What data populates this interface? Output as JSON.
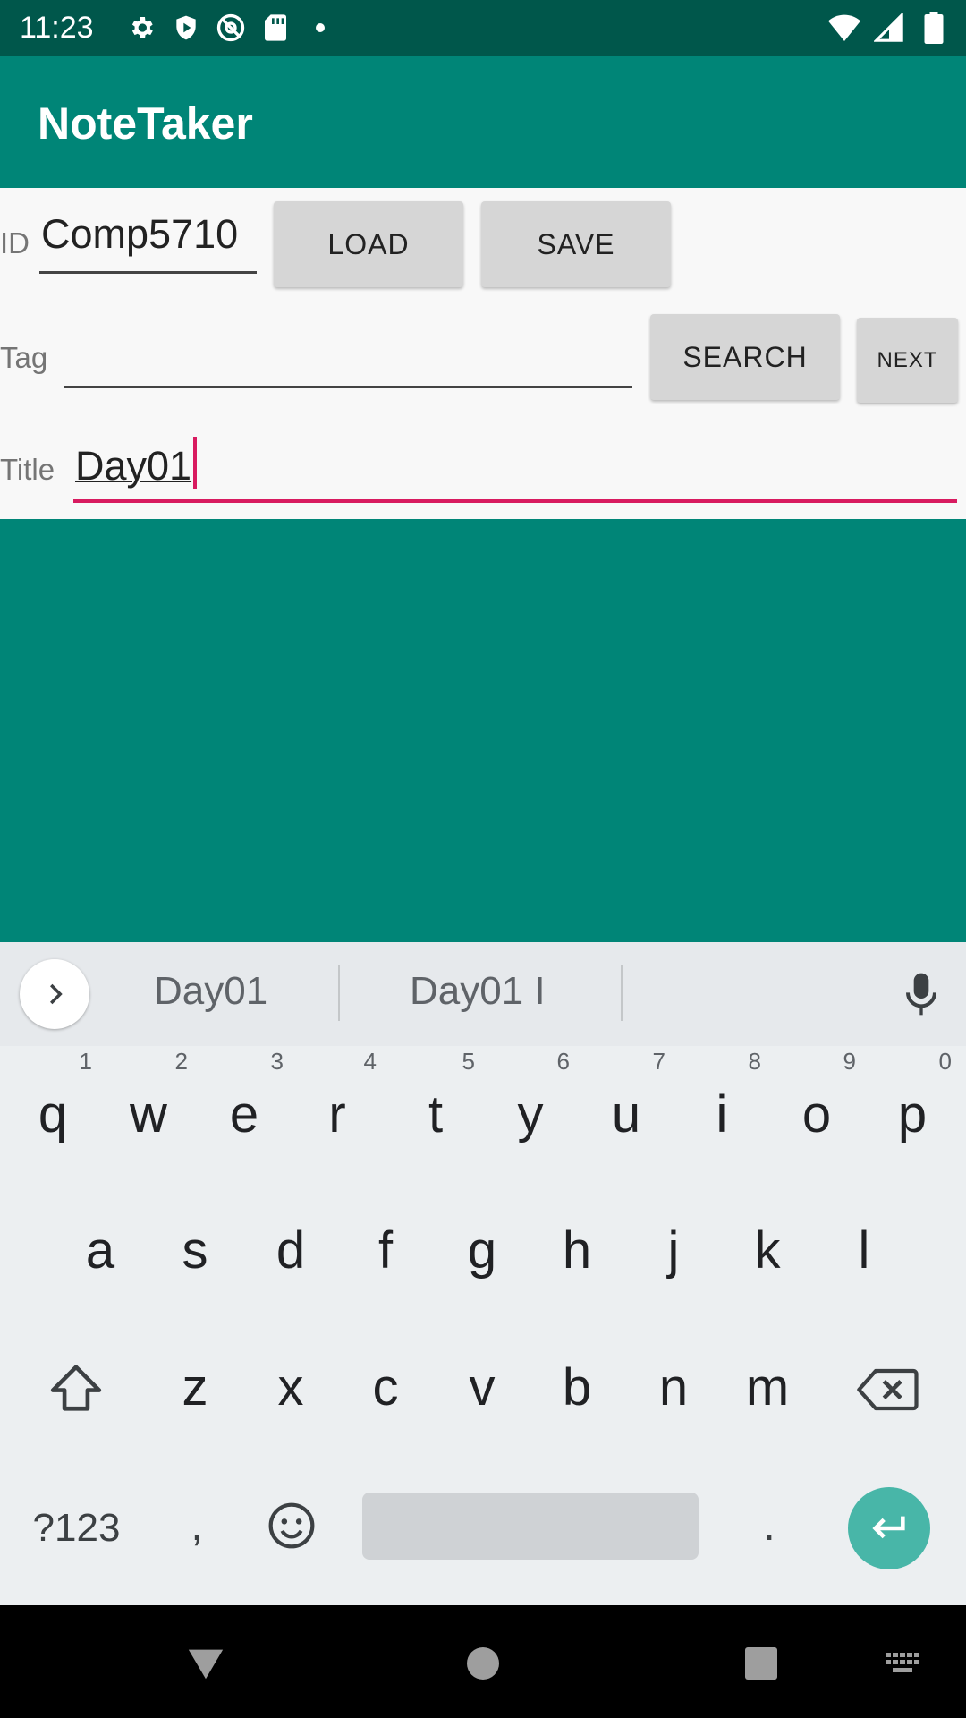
{
  "status_bar": {
    "time": "11:23",
    "left_icons": [
      "gear-icon",
      "shield-icon",
      "at-sign-icon",
      "sd-card-icon",
      "dot-icon"
    ],
    "right_icons": [
      "wifi-icon",
      "signal-icon",
      "battery-icon"
    ]
  },
  "app": {
    "title": "NoteTaker",
    "colors": {
      "primary": "#008577",
      "primary_dark": "#00574b",
      "accent": "#d81b60"
    }
  },
  "form": {
    "id_label": "ID",
    "id_value": "Comp5710",
    "load_label": "LOAD",
    "save_label": "SAVE",
    "tag_label": "Tag",
    "tag_value": "",
    "search_label": "SEARCH",
    "next_label": "NEXT",
    "title_label": "Title",
    "title_value": "Day01"
  },
  "keyboard": {
    "suggestions": [
      "Day01",
      "Day01 I"
    ],
    "row1": [
      {
        "key": "q",
        "hint": "1"
      },
      {
        "key": "w",
        "hint": "2"
      },
      {
        "key": "e",
        "hint": "3"
      },
      {
        "key": "r",
        "hint": "4"
      },
      {
        "key": "t",
        "hint": "5"
      },
      {
        "key": "y",
        "hint": "6"
      },
      {
        "key": "u",
        "hint": "7"
      },
      {
        "key": "i",
        "hint": "8"
      },
      {
        "key": "o",
        "hint": "9"
      },
      {
        "key": "p",
        "hint": "0"
      }
    ],
    "row2": [
      "a",
      "s",
      "d",
      "f",
      "g",
      "h",
      "j",
      "k",
      "l"
    ],
    "row3": [
      "z",
      "x",
      "c",
      "v",
      "b",
      "n",
      "m"
    ],
    "symbols_label": "?123",
    "comma": ",",
    "period": "."
  },
  "nav_bar": {
    "buttons": [
      "back-icon",
      "home-icon",
      "recents-icon",
      "keyboard-switch-icon"
    ]
  }
}
